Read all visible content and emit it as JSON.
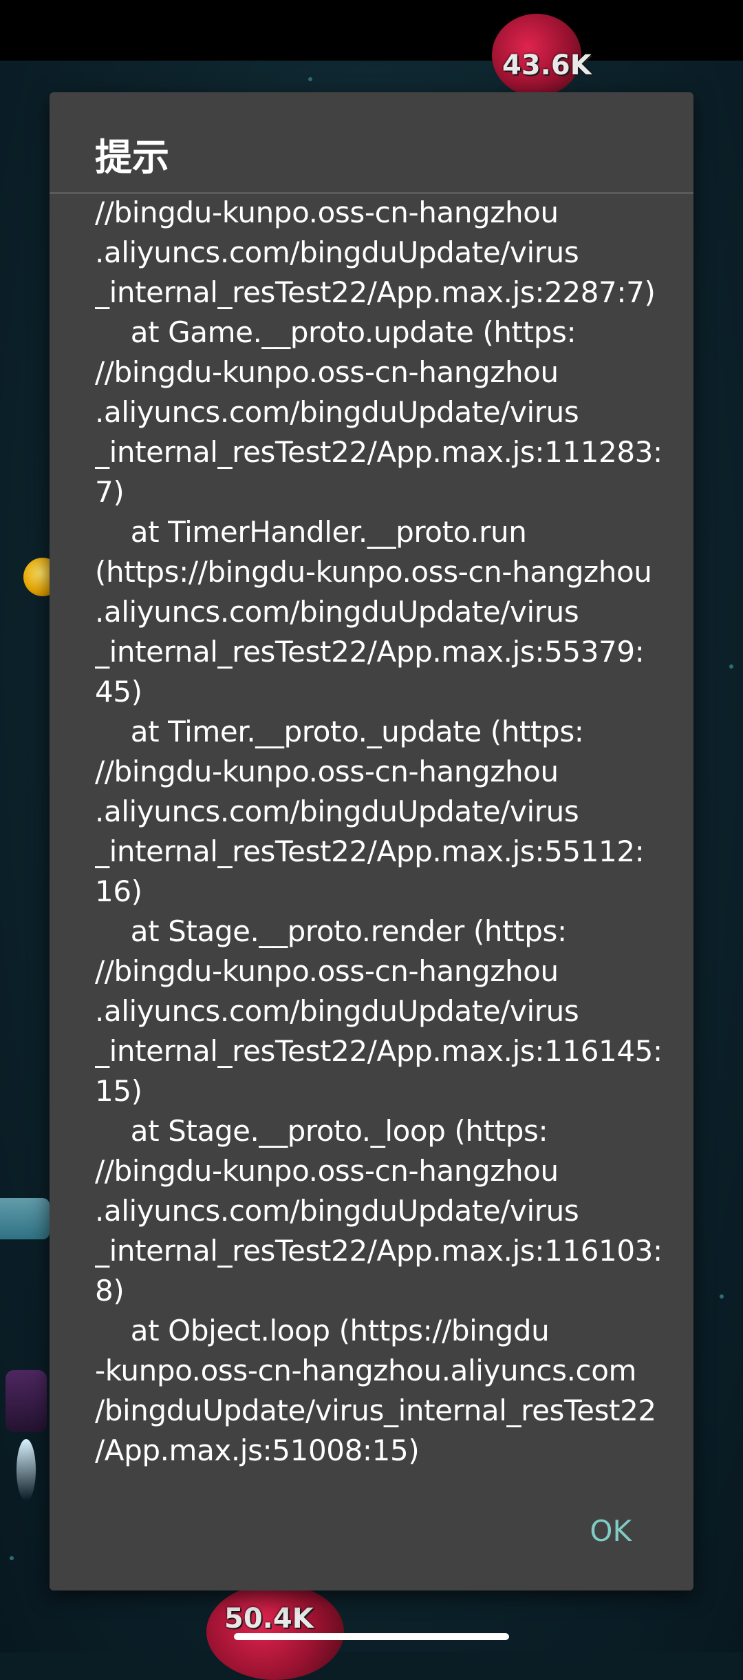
{
  "dialog": {
    "title": "提示",
    "ok_label": "OK",
    "message_lines": [
      "//bingdu-kunpo.oss-cn-hangzhou",
      ".aliyuncs.com/bingduUpdate/virus",
      "_internal_resTest22/App.max.js:2287:7)",
      "    at Game.__proto.update (https:",
      "//bingdu-kunpo.oss-cn-hangzhou",
      ".aliyuncs.com/bingduUpdate/virus",
      "_internal_resTest22/App.max.js:111283:",
      "7)",
      "    at TimerHandler.__proto.run",
      "(https://bingdu-kunpo.oss-cn-hangzhou",
      ".aliyuncs.com/bingduUpdate/virus",
      "_internal_resTest22/App.max.js:55379:",
      "45)",
      "    at Timer.__proto._update (https:",
      "//bingdu-kunpo.oss-cn-hangzhou",
      ".aliyuncs.com/bingduUpdate/virus",
      "_internal_resTest22/App.max.js:55112:",
      "16)",
      "    at Stage.__proto.render (https:",
      "//bingdu-kunpo.oss-cn-hangzhou",
      ".aliyuncs.com/bingduUpdate/virus",
      "_internal_resTest22/App.max.js:116145:",
      "15)",
      "    at Stage.__proto._loop (https:",
      "//bingdu-kunpo.oss-cn-hangzhou",
      ".aliyuncs.com/bingduUpdate/virus",
      "_internal_resTest22/App.max.js:116103:",
      "8)",
      "    at Object.loop (https://bingdu",
      "-kunpo.oss-cn-hangzhou.aliyuncs.com",
      "/bingduUpdate/virus_internal_resTest22",
      "/App.max.js:51008:15)"
    ]
  },
  "game": {
    "virus_top_label": "43.6K",
    "virus_bottom_label": "50.4K"
  }
}
